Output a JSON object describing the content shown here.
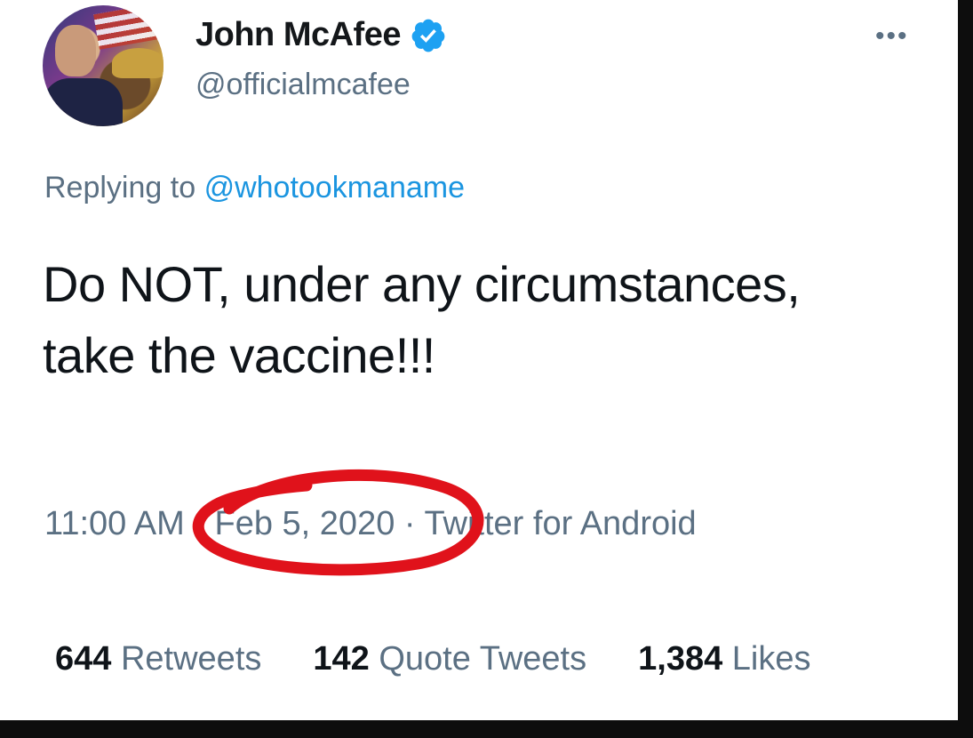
{
  "profile": {
    "name": "John McAfee",
    "handle": "@officialmcafee",
    "avatar_icon": "profile-photo",
    "verified_icon": "verified-badge-icon",
    "verified_color": "#1da1f2"
  },
  "more_label": "•••",
  "reply": {
    "prefix": "Replying to",
    "to": "@whotookmaname"
  },
  "tweet": {
    "text": "Do NOT, under any circumstances, take the vaccine!!!"
  },
  "meta": {
    "time": "11:00 AM",
    "separator": "·",
    "date": "Feb 5, 2020",
    "source": "Twitter for Android"
  },
  "stats": {
    "retweets_count": "644",
    "retweets_label": "Retweets",
    "quotes_count": "142",
    "quotes_label": "Quote Tweets",
    "likes_count": "1,384",
    "likes_label": "Likes"
  },
  "colors": {
    "link": "#1b95e0",
    "secondary_text": "#5b7083",
    "annotation": "#e0121b"
  }
}
